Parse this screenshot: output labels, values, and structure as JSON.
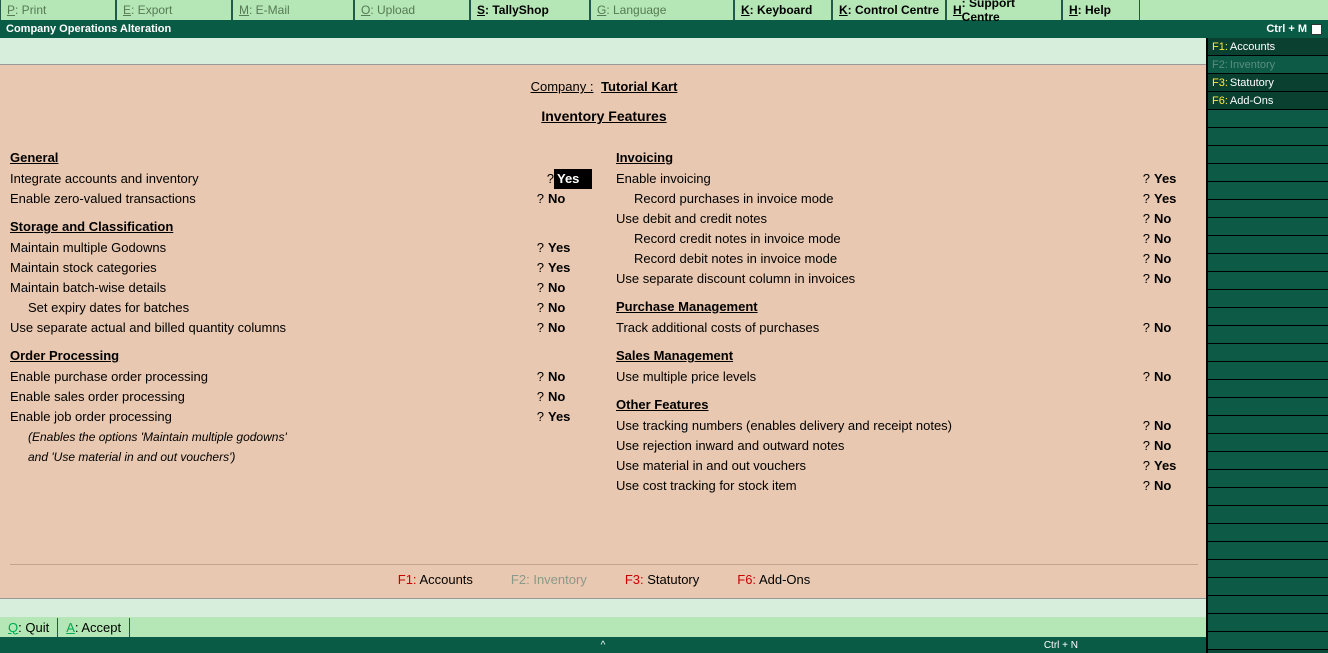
{
  "top_menu": {
    "print": {
      "key": "P",
      "label": ": Print"
    },
    "export": {
      "key": "E",
      "label": ": Export"
    },
    "email": {
      "key": "M",
      "label": ": E-Mail"
    },
    "upload": {
      "key": "O",
      "label": ": Upload"
    },
    "tallyshop": {
      "key": "S",
      "label": ": TallyShop"
    },
    "language": {
      "key": "G",
      "label": ": Language"
    },
    "keyboard": {
      "key": "K",
      "label": ": Keyboard"
    },
    "control": {
      "key": "K",
      "label": ": Control Centre"
    },
    "support": {
      "key": "H",
      "label": ": Support Centre"
    },
    "help": {
      "key": "H",
      "label": ": Help"
    }
  },
  "title_bar": {
    "title": "Company Operations  Alteration",
    "shortcut": "Ctrl + M"
  },
  "company": {
    "label": "Company :",
    "name": "Tutorial Kart"
  },
  "heading": "Inventory Features",
  "left": {
    "general": {
      "h": "General",
      "integrate": {
        "label": "Integrate accounts and inventory",
        "q": "?",
        "val": "Yes"
      },
      "zero": {
        "label": "Enable zero-valued transactions",
        "q": "?",
        "val": "No"
      }
    },
    "storage": {
      "h": "Storage and Classification",
      "godowns": {
        "label": "Maintain multiple Godowns",
        "q": "?",
        "val": "Yes"
      },
      "stockcat": {
        "label": "Maintain stock categories",
        "q": "?",
        "val": "Yes"
      },
      "batch": {
        "label": "Maintain batch-wise details",
        "q": "?",
        "val": "No"
      },
      "batch_sub": {
        "label": "Set expiry dates for batches",
        "q": "?",
        "val": "No"
      },
      "actual": {
        "label": "Use separate actual and billed quantity columns",
        "q": "?",
        "val": "No"
      }
    },
    "order": {
      "h": "Order Processing",
      "purchase": {
        "label": "Enable purchase order processing",
        "q": "?",
        "val": "No"
      },
      "sales": {
        "label": "Enable sales order processing",
        "q": "?",
        "val": "No"
      },
      "job": {
        "label": "Enable job order processing",
        "q": "?",
        "val": "Yes"
      },
      "job_note1": "(Enables the options 'Maintain multiple godowns'",
      "job_note2": "and 'Use material in and out vouchers')"
    }
  },
  "right": {
    "invoicing": {
      "h": "Invoicing",
      "enable": {
        "label": "Enable invoicing",
        "q": "?",
        "val": "Yes"
      },
      "enable_sub": {
        "label": "Record purchases in invoice mode",
        "q": "?",
        "val": "Yes"
      },
      "dc": {
        "label": "Use debit and credit notes",
        "q": "?",
        "val": "No"
      },
      "dc_sub1": {
        "label": "Record credit notes in invoice mode",
        "q": "?",
        "val": "No"
      },
      "dc_sub2": {
        "label": "Record debit notes in invoice mode",
        "q": "?",
        "val": "No"
      },
      "discount": {
        "label": "Use separate discount column in invoices",
        "q": "?",
        "val": "No"
      }
    },
    "purchase": {
      "h": "Purchase Management",
      "track": {
        "label": "Track additional costs of purchases",
        "q": "?",
        "val": "No"
      }
    },
    "sales": {
      "h": "Sales Management",
      "price": {
        "label": "Use multiple price levels",
        "q": "?",
        "val": "No"
      }
    },
    "other": {
      "h": "Other Features",
      "tracking": {
        "label": "Use tracking numbers (enables delivery and receipt notes)",
        "q": "?",
        "val": "No"
      },
      "rejection": {
        "label": "Use rejection inward and outward notes",
        "q": "?",
        "val": "No"
      },
      "material": {
        "label": "Use material in and out vouchers",
        "q": "?",
        "val": "Yes"
      },
      "cost": {
        "label": "Use cost tracking for stock item",
        "q": "?",
        "val": "No"
      }
    }
  },
  "fn_inside": {
    "f1": {
      "k": "F1:",
      "l": " Accounts"
    },
    "f2": {
      "k": "F2:",
      "l": " Inventory"
    },
    "f3": {
      "k": "F3:",
      "l": " Statutory"
    },
    "f6": {
      "k": "F6:",
      "l": " Add-Ons"
    }
  },
  "bottom": {
    "quit": {
      "key": "Q",
      "label": ": Quit"
    },
    "accept": {
      "key": "A",
      "label": ": Accept"
    }
  },
  "side": {
    "f1": {
      "k": "F1:",
      "l": " Accounts"
    },
    "f2": {
      "k": "F2:",
      "l": " Inventory"
    },
    "f3": {
      "k": "F3:",
      "l": " Statutory"
    },
    "f6": {
      "k": "F6:",
      "l": " Add-Ons"
    }
  },
  "strip": {
    "ctrl": "Ctrl + N"
  }
}
